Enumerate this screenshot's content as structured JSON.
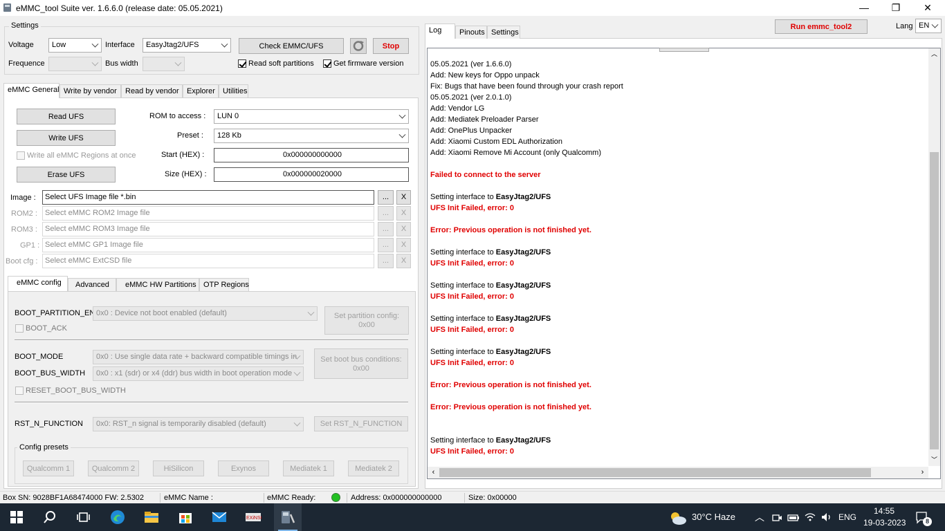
{
  "window": {
    "title": "eMMC_tool Suite  ver. 1.6.6.0 (release date: 05.05.2021)",
    "minimize": "—",
    "maximize": "❐",
    "close": "✕"
  },
  "settings": {
    "group_label": "Settings",
    "voltage_label": "Voltage",
    "voltage_value": "Low",
    "interface_label": "Interface",
    "interface_value": "EasyJtag2/UFS",
    "check_button": "Check EMMC/UFS",
    "stop_button": "Stop",
    "frequence_label": "Frequence",
    "frequence_value": "",
    "bus_width_label": "Bus width",
    "bus_width_value": "",
    "read_soft_partitions": "Read soft partitions",
    "get_firmware_version": "Get firmware version"
  },
  "main_tabs": [
    "eMMC General",
    "Write by vendor",
    "Read by vendor",
    "Explorer",
    "Utilities"
  ],
  "general": {
    "read_button": "Read UFS",
    "write_button": "Write UFS",
    "write_all_label": "Write all eMMC Regions at once",
    "erase_button": "Erase UFS",
    "rom_label": "ROM to access :",
    "rom_value": "LUN 0",
    "preset_label": "Preset :",
    "preset_value": "128 Kb",
    "start_label": "Start (HEX) :",
    "start_value": "0x000000000000",
    "size_label": "Size (HEX) :",
    "size_value": "0x000000020000"
  },
  "files": [
    {
      "label": "Image  :",
      "placeholder": "Select UFS Image file *.bin",
      "browse": "...",
      "clear": "X"
    },
    {
      "label": "ROM2  :",
      "placeholder": "Select eMMC ROM2 Image file",
      "browse": "...",
      "clear": "X"
    },
    {
      "label": "ROM3  :",
      "placeholder": "Select eMMC ROM3 Image file",
      "browse": "...",
      "clear": "X"
    },
    {
      "label": "GP1  :",
      "placeholder": "Select eMMC GP1 Image file",
      "browse": "...",
      "clear": "X"
    },
    {
      "label": "Boot cfg  :",
      "placeholder": "Select eMMC ExtCSD file",
      "browse": "...",
      "clear": "X"
    }
  ],
  "config_tabs": [
    "eMMC config",
    "Advanced",
    "eMMC HW Partitions",
    "OTP Regions"
  ],
  "config": {
    "boot_partition_label": "BOOT_PARTITION_EN",
    "boot_partition_value": "0x0 : Device not boot enabled (default)",
    "boot_ack_label": "BOOT_ACK",
    "set_partition_button": "Set partition config:\n0x00",
    "boot_mode_label": "BOOT_MODE",
    "boot_mode_value": "0x0 : Use single data rate + backward compatible timings in",
    "boot_bus_width_label": "BOOT_BUS_WIDTH",
    "boot_bus_width_value": "0x0 : x1 (sdr) or x4 (ddr) bus width in boot operation mode",
    "set_boot_bus_button": "Set boot bus conditions:\n0x00",
    "reset_boot_bus_label": "RESET_BOOT_BUS_WIDTH",
    "rst_n_label": "RST_N_FUNCTION",
    "rst_n_value": "0x0: RST_n signal is temporarily disabled (default)",
    "set_rst_n_button": "Set RST_N_FUNCTION",
    "presets_label": "Config presets",
    "presets": [
      "Qualcomm 1",
      "Qualcomm 2",
      "HiSilicon",
      "Exynos",
      "Mediatek 1",
      "Mediatek 2"
    ]
  },
  "right": {
    "tabs": [
      "Log",
      "Pinouts",
      "Settings"
    ],
    "run_button": "Run emmc_tool2",
    "lang_label": "Lang",
    "lang_value": "EN"
  },
  "log": [
    {
      "text": "05.05.2021 (ver 1.6.6.0)",
      "style": "normal"
    },
    {
      "text": "   Add:   New keys for Oppo unpack",
      "style": "normal"
    },
    {
      "text": "   Fix:   Bugs that have been found through your crash report",
      "style": "normal"
    },
    {
      "text": "05.05.2021 (ver 2.0.1.0)",
      "style": "normal"
    },
    {
      "text": "   Add:   Vendor LG",
      "style": "normal"
    },
    {
      "text": "   Add:   Mediatek Preloader Parser",
      "style": "normal"
    },
    {
      "text": "   Add:   OnePlus Unpacker",
      "style": "normal"
    },
    {
      "text": "   Add:   Xiaomi Custom EDL Authorization",
      "style": "normal"
    },
    {
      "text": "   Add:   Xiaomi Remove Mi Account (only Qualcomm)",
      "style": "normal"
    },
    {
      "text": "",
      "style": "normal"
    },
    {
      "text": "Failed to connect to the server",
      "style": "red"
    },
    {
      "text": "",
      "style": "normal"
    },
    {
      "text": "Setting interface to |EasyJtag2/UFS",
      "style": "mixed"
    },
    {
      "text": "UFS Init Failed, error: 0",
      "style": "red"
    },
    {
      "text": "",
      "style": "normal"
    },
    {
      "text": "Error: Previous operation is not finished yet.",
      "style": "red"
    },
    {
      "text": "",
      "style": "normal"
    },
    {
      "text": "Setting interface to |EasyJtag2/UFS",
      "style": "mixed"
    },
    {
      "text": "UFS Init Failed, error: 0",
      "style": "red"
    },
    {
      "text": "",
      "style": "normal"
    },
    {
      "text": "Setting interface to |EasyJtag2/UFS",
      "style": "mixed"
    },
    {
      "text": "UFS Init Failed, error: 0",
      "style": "red"
    },
    {
      "text": "",
      "style": "normal"
    },
    {
      "text": "Setting interface to |EasyJtag2/UFS",
      "style": "mixed"
    },
    {
      "text": "UFS Init Failed, error: 0",
      "style": "red"
    },
    {
      "text": "",
      "style": "normal"
    },
    {
      "text": "Setting interface to |EasyJtag2/UFS",
      "style": "mixed"
    },
    {
      "text": "UFS Init Failed, error: 0",
      "style": "red"
    },
    {
      "text": "",
      "style": "normal"
    },
    {
      "text": "Error: Previous operation is not finished yet.",
      "style": "red"
    },
    {
      "text": "",
      "style": "normal"
    },
    {
      "text": "Error: Previous operation is not finished yet.",
      "style": "red"
    },
    {
      "text": "",
      "style": "normal"
    },
    {
      "text": "",
      "style": "normal"
    },
    {
      "text": "Setting interface to |EasyJtag2/UFS",
      "style": "mixed"
    },
    {
      "text": "UFS Init Failed, error: 0",
      "style": "red"
    }
  ],
  "status": {
    "box_sn": "Box SN:  9028BF1A68474000  FW:  2.5302",
    "emmc_name": "eMMC Name :",
    "emmc_ready": "eMMC Ready:",
    "ready_color": "#22c022",
    "address": "Address: 0x000000000000",
    "size": "Size: 0x00000"
  },
  "taskbar": {
    "weather": "30°C  Haze",
    "lang": "ENG",
    "time": "14:55",
    "date": "19-03-2023",
    "notifications": "8",
    "icons": [
      "windows-start-icon",
      "search-icon",
      "task-view-icon",
      "edge-icon",
      "file-explorer-icon",
      "store-icon",
      "mail-icon",
      "exinsoft-icon",
      "emmc-tool-icon"
    ]
  }
}
